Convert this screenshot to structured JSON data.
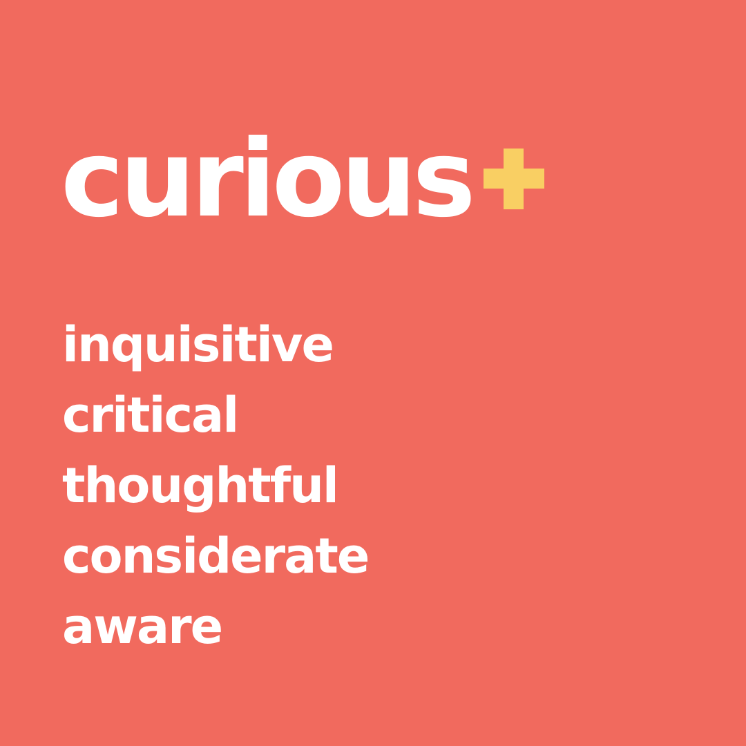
{
  "heading": {
    "word": "curious"
  },
  "icon": {
    "name": "plus-icon",
    "color": "#F9CF63"
  },
  "words": [
    "inquisitive",
    "critical",
    "thoughtful",
    "considerate",
    "aware"
  ],
  "colors": {
    "background": "#F16A5E",
    "text": "#FFFFFF",
    "accent": "#F9CF63"
  }
}
